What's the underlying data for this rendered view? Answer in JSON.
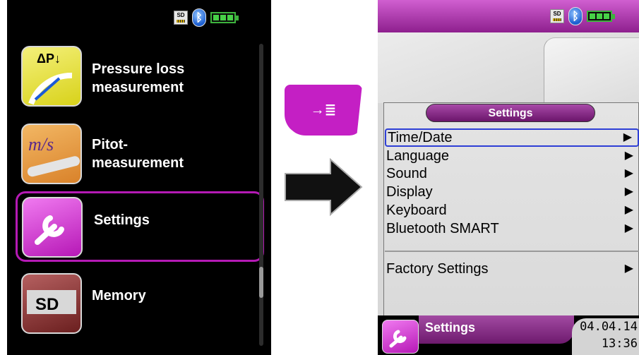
{
  "status": {
    "sd_label": "SD",
    "bluetooth_glyph": "ᛒ"
  },
  "left_menu": {
    "items": [
      {
        "label_line1": "Pressure loss",
        "label_line2": "measurement",
        "icon": "pressure-gauge-icon",
        "icon_text": "ΔP↓"
      },
      {
        "label_line1": "Pitot-",
        "label_line2": "measurement",
        "icon": "pitot-tube-icon",
        "icon_text": "m/s"
      },
      {
        "label": "Settings",
        "icon": "wrench-icon",
        "selected": true
      },
      {
        "label": "Memory",
        "icon": "sd-card-icon",
        "icon_text": "SD"
      }
    ]
  },
  "key_button": {
    "glyph": "→≣"
  },
  "right_screen": {
    "panel_title": "Settings",
    "items": [
      {
        "label": "Time/Date",
        "arrow": "▶",
        "highlighted": true
      },
      {
        "label": "Language",
        "arrow": "▶"
      },
      {
        "label": "Sound",
        "arrow": "▶"
      },
      {
        "label": "Display",
        "arrow": "▶"
      },
      {
        "label": "Keyboard",
        "arrow": "▶"
      },
      {
        "label": "Bluetooth SMART",
        "arrow": "▶"
      },
      {
        "label": "Factory Settings",
        "arrow": "▶"
      }
    ],
    "footer": {
      "title": "Settings",
      "date": "04.04.14",
      "time": "13:36"
    }
  },
  "colors": {
    "accent": "#b51ab5",
    "highlight": "#2e3fd6",
    "battery": "#47d147"
  }
}
